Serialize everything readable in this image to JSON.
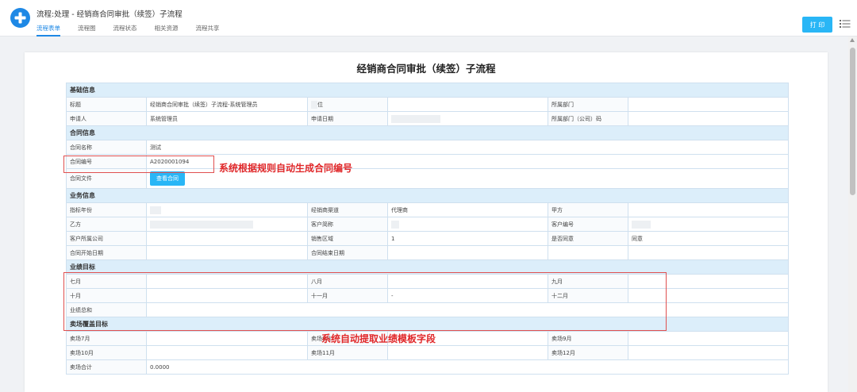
{
  "header": {
    "title": "流程:处理 - 经销商合同审批（续签）子流程",
    "tabs": [
      "流程表单",
      "流程图",
      "流程状态",
      "相关资源",
      "流程共享"
    ],
    "print_label": "打 印"
  },
  "doc": {
    "title": "经销商合同审批（续签）子流程",
    "basic": {
      "section": "基础信息",
      "title_label": "标题",
      "title_value": "经销商合同审批（续签）子流程-系统管理员",
      "position_label": "位",
      "dept_label": "所属部门",
      "applicant_label": "申请人",
      "applicant_value": "系统管理员",
      "apply_date_label": "申请日期",
      "dept_code_label": "所属部门（公司）码"
    },
    "contract": {
      "section": "合同信息",
      "name_label": "合同名称",
      "name_value": "测试",
      "no_label": "合同编号",
      "no_value": "A2020001094",
      "file_label": "合同文件",
      "view_button": "查看合同"
    },
    "business": {
      "section": "业务信息",
      "year_label": "指标年份",
      "channel_label": "经销商渠道",
      "channel_value": "代理商",
      "party_a_label": "甲方",
      "party_b_label": "乙方",
      "customer_short_label": "客户简称",
      "customer_no_label": "客户编号",
      "customer_company_label": "客户所属公司",
      "region_label": "销售区域",
      "region_value": "1",
      "agree_label": "是否同意",
      "agree_value": "同意",
      "start_label": "合同开始日期",
      "end_label": "合同结束日期"
    },
    "performance": {
      "section": "业绩目标",
      "m7": "七月",
      "m8": "八月",
      "m9": "九月",
      "m10": "十月",
      "m11": "十一月",
      "m11_value": "-",
      "m12": "十二月",
      "total": "业绩总和"
    },
    "coverage": {
      "section": "卖场覆盖目标",
      "s7": "卖场7月",
      "s8": "卖场8月",
      "s9": "卖场9月",
      "s10": "卖场10月",
      "s11": "卖场11月",
      "s12": "卖场12月",
      "total": "卖场合计",
      "total_value": "0.0000"
    }
  },
  "annotations": {
    "contract_no_note": "系统根据规则自动生成合同编号",
    "template_note": "系统自动提取业绩模板字段"
  },
  "colors": {
    "accent": "#1e88e5",
    "button": "#29b6f6",
    "section_bg": "#dceefa",
    "annotation": "#e0282a"
  }
}
